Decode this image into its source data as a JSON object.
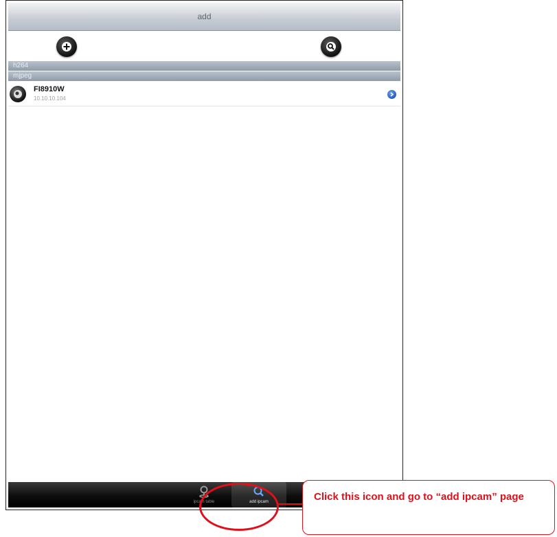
{
  "navbar": {
    "title": "add"
  },
  "toolbar": {
    "add_icon": "plus-circle-icon",
    "search_icon": "search-circle-icon"
  },
  "sections": [
    {
      "title": "h264"
    },
    {
      "title": "mjpeg"
    }
  ],
  "cameras": [
    {
      "name": "FI8910W",
      "ip": "10.10.10.104",
      "icon": "camera-icon",
      "accessory": "disclosure-icon"
    }
  ],
  "tabbar": {
    "tabs": [
      {
        "label": "ipcam table",
        "icon": "person-pin-icon",
        "selected": false
      },
      {
        "label": "add ipcam",
        "icon": "magnifier-icon",
        "selected": true
      }
    ]
  },
  "annotation": {
    "text": "Click this icon and go to “add ipcam” page",
    "color": "#e0101a"
  }
}
